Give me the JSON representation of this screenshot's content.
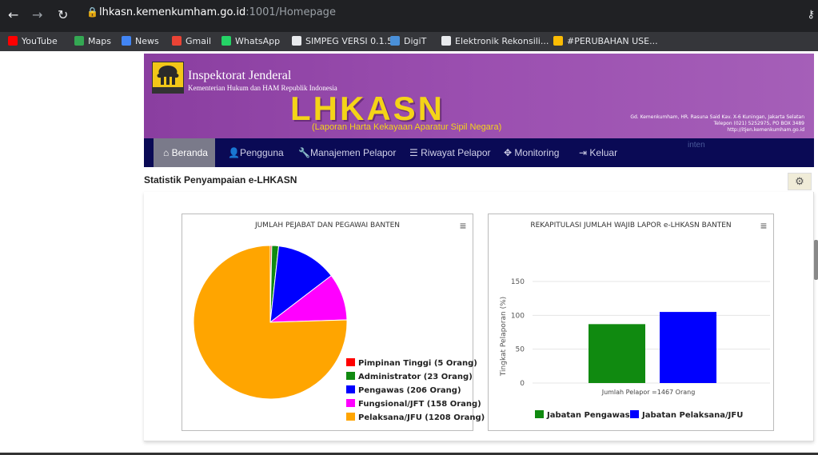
{
  "browser": {
    "url_host": "lhkasn.kemenkumham.go.id",
    "url_path": ":1001/Homepage",
    "bookmarks": [
      {
        "label": "YouTube",
        "icon": "youtube-icon",
        "color": "#ff0000"
      },
      {
        "label": "Maps",
        "icon": "maps-icon",
        "color": "#34a853"
      },
      {
        "label": "News",
        "icon": "news-icon",
        "color": "#4285f4"
      },
      {
        "label": "Gmail",
        "icon": "gmail-icon",
        "color": "#ea4335"
      },
      {
        "label": "WhatsApp",
        "icon": "whatsapp-icon",
        "color": "#25d366"
      },
      {
        "label": "SIMPEG VERSI 0.1.5",
        "icon": "globe-icon",
        "color": "#e8eaed"
      },
      {
        "label": "DigiT",
        "icon": "doc-icon",
        "color": "#4a90d9"
      },
      {
        "label": "Elektronik Rekonsili...",
        "icon": "globe-icon",
        "color": "#e8eaed"
      },
      {
        "label": "#PERUBAHAN USE...",
        "icon": "drive-icon",
        "color": "#fbbc04"
      }
    ]
  },
  "header": {
    "title": "Inspektorat Jenderal",
    "subtitle": "Kementerian Hukum dan HAM Republik Indonesia",
    "emblem_text": "PENGAYOMAN",
    "app_name": "LHKASN",
    "app_subtitle": "(Laporan Harta Kekayaan Aparatur Sipil Negara)",
    "address_line1": "Gd. Kemenkumham, HR. Rasuna Said Kav. X-6 Kuningan, Jakarta Selatan",
    "address_line2": "Telepon (021) 5252975, PO BOX 3489",
    "address_line3": "http://itjen.kemenkumham.go.id"
  },
  "nav": {
    "items": [
      {
        "label": "Beranda",
        "icon": "home-icon"
      },
      {
        "label": "Pengguna",
        "icon": "user-icon"
      },
      {
        "label": "Manajemen Pelapor",
        "icon": "wrench-icon"
      },
      {
        "label": "Riwayat Pelapor",
        "icon": "list-icon"
      },
      {
        "label": "Monitoring",
        "icon": "move-icon"
      },
      {
        "label": "Keluar",
        "icon": "logout-icon"
      }
    ],
    "faded_text": "inten"
  },
  "content": {
    "title": "Statistik Penyampaian e-LHKASN"
  },
  "chart_data": [
    {
      "type": "pie",
      "title": "JUMLAH PEJABAT DAN PEGAWAI BANTEN",
      "legend_position": "bottom-right",
      "slices": [
        {
          "label": "Pimpinan Tinggi (5 Orang)",
          "value": 5,
          "color": "#ff0000"
        },
        {
          "label": "Administrator (23 Orang)",
          "value": 23,
          "color": "#108a10"
        },
        {
          "label": "Pengawas (206 Orang)",
          "value": 206,
          "color": "#0000ff"
        },
        {
          "label": "Fungsional/JFT (158 Orang)",
          "value": 158,
          "color": "#ff00ff"
        },
        {
          "label": "Pelaksana/JFU (1208 Orang)",
          "value": 1208,
          "color": "#ffa500"
        }
      ]
    },
    {
      "type": "bar",
      "title": "REKAPITULASI JUMLAH WAJIB LAPOR e-LHKASN BANTEN",
      "ylabel": "Tingkat Pelaporan (%)",
      "xlabel": "Jumlah Pelapor =1467 Orang",
      "ylim": [
        0,
        150
      ],
      "yticks": [
        0,
        50,
        100,
        150
      ],
      "grid": true,
      "legend_position": "bottom",
      "series": [
        {
          "name": "Jabatan Pengawas",
          "value": 87,
          "color": "#108a10"
        },
        {
          "name": "Jabatan Pelaksana/JFU",
          "value": 105,
          "color": "#0000ff"
        }
      ]
    }
  ]
}
